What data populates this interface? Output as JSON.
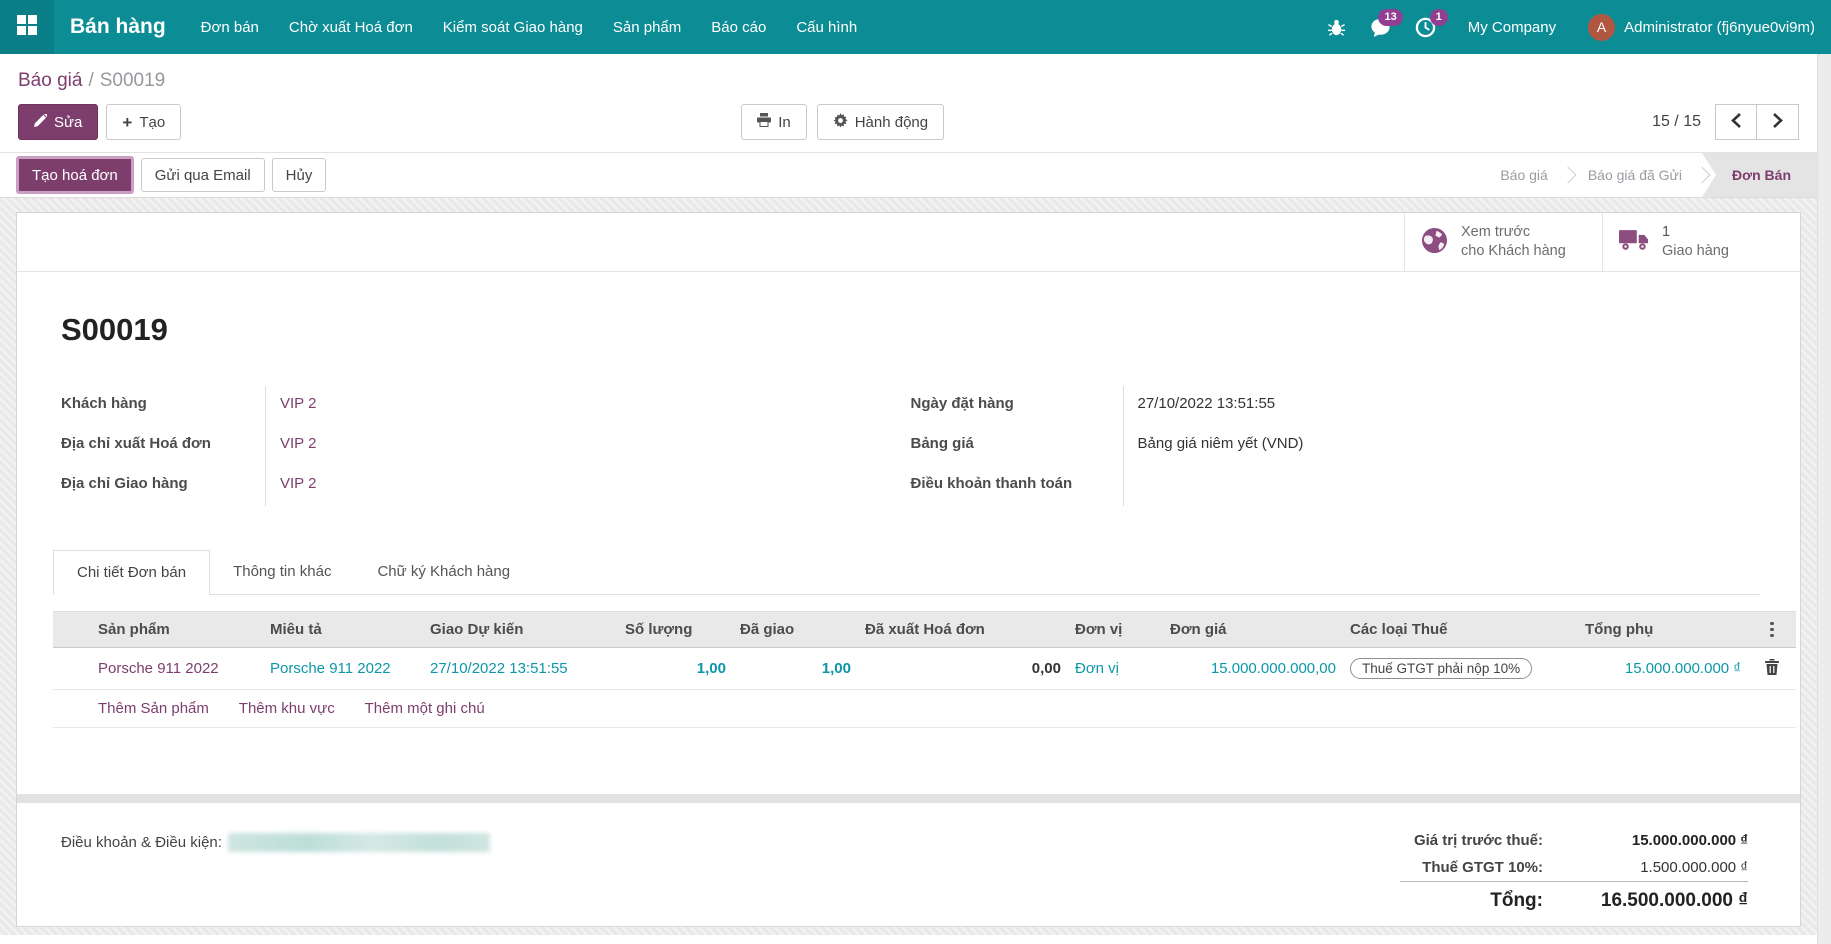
{
  "colors": {
    "navbar_teal": "#0c8d95",
    "accent_purple": "#7d3e6e",
    "list_teal": "#0d97a8",
    "badge_purple": "#913f92",
    "avatar_rust": "#b15741"
  },
  "navbar": {
    "brand": "Bán hàng",
    "items": [
      "Đơn bán",
      "Chờ xuất Hoá đơn",
      "Kiểm soát Giao hàng",
      "Sản phẩm",
      "Báo cáo",
      "Cấu hình"
    ],
    "message_badge": "13",
    "activity_badge": "1",
    "company": "My Company",
    "avatar_letter": "A",
    "user": "Administrator (fj6nyue0vi9m)"
  },
  "breadcrumb": {
    "parent": "Báo giá",
    "separator": "/",
    "current": "S00019"
  },
  "actions": {
    "edit": "Sửa",
    "create": "Tạo",
    "print": "In",
    "action": "Hành động"
  },
  "pager": {
    "text": "15 / 15"
  },
  "statusbar": {
    "invoice_btn": "Tạo hoá đơn",
    "email_btn": "Gửi qua Email",
    "cancel_btn": "Hủy",
    "states": [
      "Báo giá",
      "Báo giá đã Gửi",
      "Đơn Bán"
    ]
  },
  "smart_buttons": {
    "preview_line1": "Xem trước",
    "preview_line2": "cho Khách hàng",
    "delivery_count": "1",
    "delivery_label": "Giao hàng"
  },
  "record": {
    "title": "S00019",
    "fields_left": [
      {
        "label": "Khách hàng",
        "value": "VIP 2"
      },
      {
        "label": "Địa chỉ xuất Hoá đơn",
        "value": "VIP 2"
      },
      {
        "label": "Địa chỉ Giao hàng",
        "value": "VIP 2"
      }
    ],
    "fields_right": [
      {
        "label": "Ngày đặt hàng",
        "value": "27/10/2022 13:51:55"
      },
      {
        "label": "Bảng giá",
        "value": "Bảng giá niêm yết (VND)"
      },
      {
        "label": "Điều khoản thanh toán",
        "value": ""
      }
    ]
  },
  "tabs": [
    "Chi tiết Đơn bán",
    "Thông tin khác",
    "Chữ ký Khách hàng"
  ],
  "order_lines": {
    "headers": [
      "Sản phẩm",
      "Miêu tả",
      "Giao Dự kiến",
      "Số lượng",
      "Đã giao",
      "Đã xuất Hoá đơn",
      "Đơn vị",
      "Đơn giá",
      "Các loại Thuế",
      "Tổng phụ"
    ],
    "rows": [
      {
        "product": "Porsche 911 2022",
        "description": "Porsche 911 2022",
        "scheduled_date": "27/10/2022 13:51:55",
        "quantity": "1,00",
        "delivered": "1,00",
        "invoiced": "0,00",
        "uom": "Đơn vị",
        "unit_price": "15.000.000.000,00",
        "taxes": "Thuế GTGT phải nộp 10%",
        "subtotal": "15.000.000.000 ₫"
      }
    ],
    "footer_links": [
      "Thêm Sản phẩm",
      "Thêm khu vực",
      "Thêm một ghi chú"
    ]
  },
  "terms": {
    "label": "Điều khoản & Điều kiện:"
  },
  "totals": {
    "untaxed_label": "Giá trị trước thuế:",
    "untaxed_value": "15.000.000.000 ₫",
    "tax_label": "Thuế GTGT 10%:",
    "tax_value": "1.500.000.000 ₫",
    "total_label": "Tổng:",
    "total_value": "16.500.000.000 ₫"
  }
}
